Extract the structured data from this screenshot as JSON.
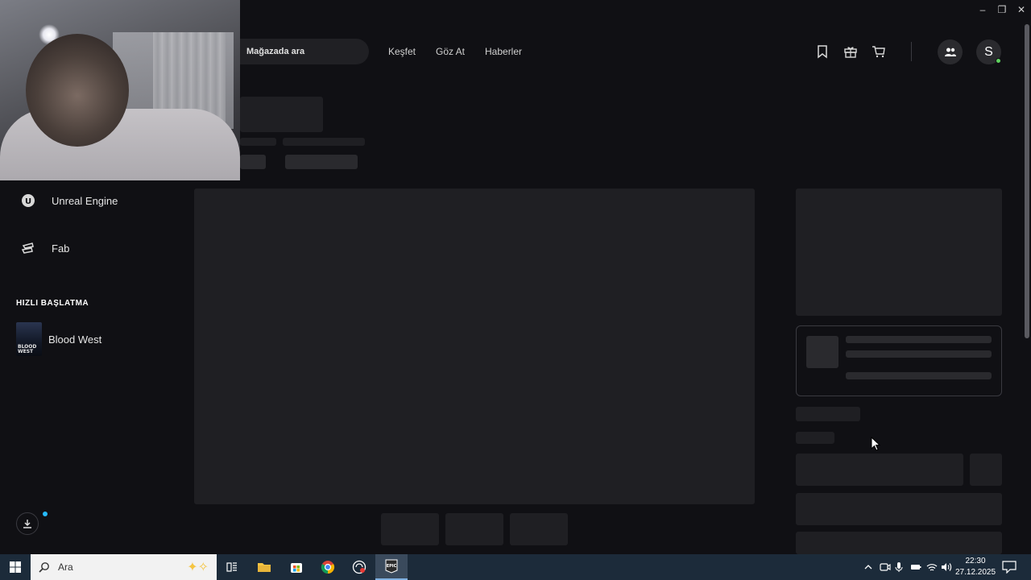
{
  "window": {
    "controls": [
      "–",
      "❐",
      "✕"
    ]
  },
  "sidebar": {
    "items": [
      {
        "label": "Unreal Engine",
        "icon": "unreal-engine-icon"
      },
      {
        "label": "Fab",
        "icon": "fab-icon"
      }
    ],
    "quick_launch_title": "HIZLI BAŞLATMA",
    "quick_launch": [
      {
        "label": "Blood West",
        "thumb_text": "BLOOD WEST"
      }
    ]
  },
  "topbar": {
    "search_placeholder": "Mağazada ara",
    "links": [
      "Keşfet",
      "Göz At",
      "Haberler"
    ],
    "avatar_letter": "S"
  },
  "taskbar": {
    "search_placeholder": "Ara",
    "time": "22:30",
    "date": "27.12.2025"
  },
  "colors": {
    "background": "#101014",
    "skeleton": "#1f1f23",
    "accent_blue": "#26bbff",
    "online_green": "#5fd35f",
    "taskbar": "#1c2b3a"
  }
}
